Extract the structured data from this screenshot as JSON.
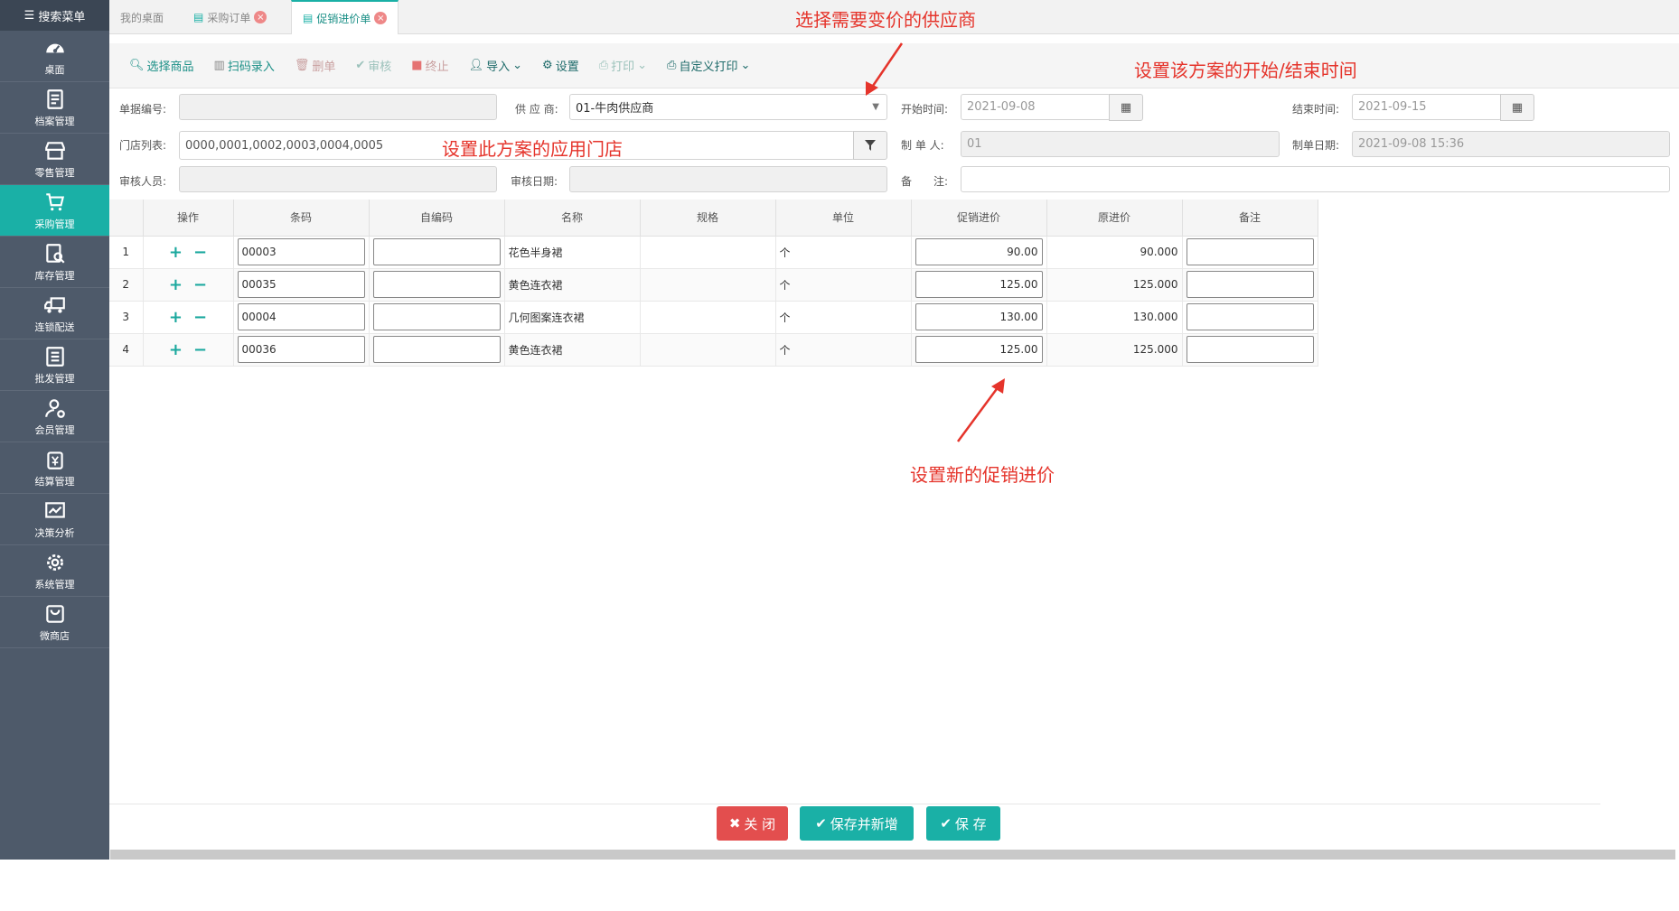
{
  "sidebar": {
    "search_label": "搜索菜单",
    "items": [
      {
        "label": "桌面",
        "icon": "dashboard-icon"
      },
      {
        "label": "档案管理",
        "icon": "file-icon"
      },
      {
        "label": "零售管理",
        "icon": "store-icon"
      },
      {
        "label": "采购管理",
        "icon": "cart-icon",
        "active": true
      },
      {
        "label": "库存管理",
        "icon": "inventory-icon"
      },
      {
        "label": "连锁配送",
        "icon": "truck-icon"
      },
      {
        "label": "批发管理",
        "icon": "wholesale-icon"
      },
      {
        "label": "会员管理",
        "icon": "member-icon"
      },
      {
        "label": "结算管理",
        "icon": "settlement-icon"
      },
      {
        "label": "决策分析",
        "icon": "chart-icon"
      },
      {
        "label": "系统管理",
        "icon": "gear-icon"
      },
      {
        "label": "微商店",
        "icon": "shop-bag-icon"
      }
    ]
  },
  "tabs": [
    {
      "label": "我的桌面"
    },
    {
      "label": "采购订单"
    },
    {
      "label": "促销进价单",
      "active": true
    }
  ],
  "toolbar": {
    "select_goods": "选择商品",
    "scan_entry": "扫码录入",
    "delete": "删单",
    "audit": "审核",
    "terminate": "终止",
    "import": "导入",
    "settings": "设置",
    "print": "打印",
    "custom_print": "自定义打印"
  },
  "form": {
    "doc_no_label": "单据编号:",
    "doc_no_value": "",
    "supplier_label": "供 应 商:",
    "supplier_value": "01-牛肉供应商",
    "start_label": "开始时间:",
    "start_value": "2021-09-08",
    "end_label": "结束时间:",
    "end_value": "2021-09-15",
    "store_label": "门店列表:",
    "store_value": "0000,0001,0002,0003,0004,0005",
    "maker_label": "制 单 人:",
    "maker_value": "01",
    "make_date_label": "制单日期:",
    "make_date_value": "2021-09-08 15:36",
    "auditor_label": "审核人员:",
    "auditor_value": "",
    "audit_date_label": "审核日期:",
    "audit_date_value": "",
    "remark_label": "备　　注:",
    "remark_value": ""
  },
  "table": {
    "headers": [
      "操作",
      "条码",
      "自编码",
      "名称",
      "规格",
      "单位",
      "促销进价",
      "原进价",
      "备注"
    ],
    "rows": [
      {
        "no": "1",
        "barcode": "00003",
        "code": "",
        "name": "花色半身裙",
        "spec": "",
        "unit": "个",
        "promo_price": "90.00",
        "orig_price": "90.000",
        "remark": ""
      },
      {
        "no": "2",
        "barcode": "00035",
        "code": "",
        "name": "黄色连衣裙",
        "spec": "",
        "unit": "个",
        "promo_price": "125.00",
        "orig_price": "125.000",
        "remark": ""
      },
      {
        "no": "3",
        "barcode": "00004",
        "code": "",
        "name": "几何图案连衣裙",
        "spec": "",
        "unit": "个",
        "promo_price": "130.00",
        "orig_price": "130.000",
        "remark": ""
      },
      {
        "no": "4",
        "barcode": "00036",
        "code": "",
        "name": "黄色连衣裙",
        "spec": "",
        "unit": "个",
        "promo_price": "125.00",
        "orig_price": "125.000",
        "remark": ""
      }
    ]
  },
  "annotations": {
    "supplier": "选择需要变价的供应商",
    "time": "设置该方案的开始/结束时间",
    "stores": "设置此方案的应用门店",
    "price": "设置新的促销进价"
  },
  "buttons": {
    "close": "关 闭",
    "save_new": "保存并新增",
    "save": "保 存"
  },
  "colors": {
    "sidebar_bg": "#4e5a6a",
    "accent": "#1ab0a6",
    "close_btn": "#e34e4e",
    "annotation": "#e5342b"
  }
}
